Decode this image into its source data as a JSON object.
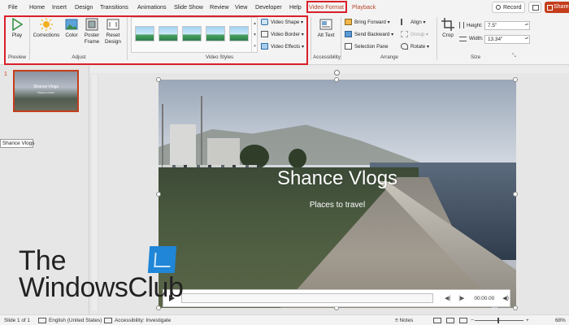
{
  "tabs": [
    "File",
    "Home",
    "Insert",
    "Design",
    "Transitions",
    "Animations",
    "Slide Show",
    "Review",
    "View",
    "Developer",
    "Help",
    "Video Format",
    "Playback"
  ],
  "header_right": {
    "record": "Record",
    "share": "Share"
  },
  "ribbon": {
    "play": "Play",
    "corrections": "Corrections",
    "color": "Color",
    "poster_frame": "Poster Frame",
    "reset_design": "Reset Design",
    "video_shape": "Video Shape",
    "video_border": "Video Border",
    "video_effects": "Video Effects",
    "alt_text": "Alt Text",
    "bring_forward": "Bring Forward",
    "send_backward": "Send Backward",
    "selection_pane": "Selection Pane",
    "align": "Align",
    "group": "Group",
    "rotate": "Rotate",
    "crop": "Crop",
    "height_label": "Height:",
    "height_value": "7.5\"",
    "width_label": "Width:",
    "width_value": "13.34\"",
    "groups": {
      "preview": "Preview",
      "adjust": "Adjust",
      "video_styles": "Video Styles",
      "accessibility": "Accessibility",
      "arrange": "Arrange",
      "size": "Size"
    }
  },
  "thumbnail": {
    "number": "1",
    "title": "Shance Vlogs",
    "subtitle": "Places to travel"
  },
  "tooltip": "Shance Vlogs",
  "slide": {
    "title": "Shance Vlogs",
    "subtitle": "Places to travel"
  },
  "video": {
    "time": "00:00.00"
  },
  "watermark": {
    "line1": "The",
    "line2": "WindowsClub"
  },
  "status": {
    "slide": "Slide 1 of 1",
    "language": "English (United States)",
    "accessibility": "Accessibility: Investigate",
    "notes": "Notes",
    "zoom": "68%"
  }
}
